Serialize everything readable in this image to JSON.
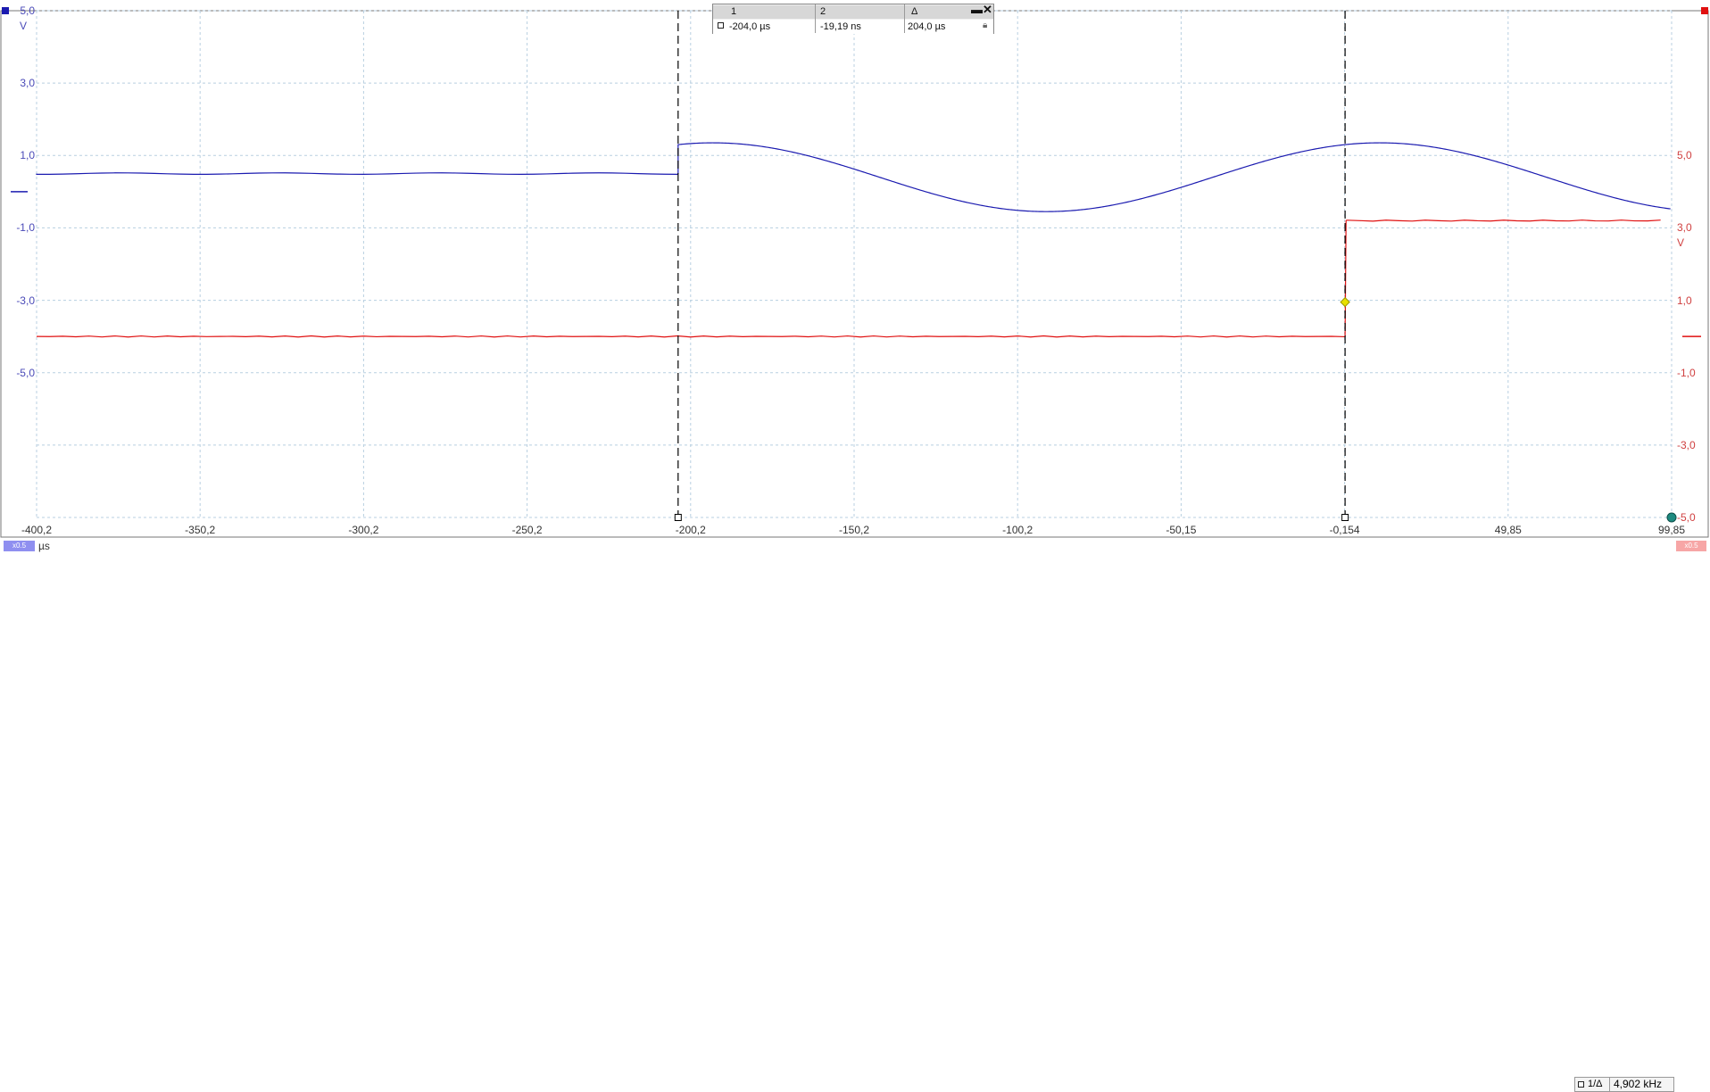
{
  "chart_data": {
    "type": "line",
    "x_unit": "µs",
    "xlim": [
      -400.2,
      99.85
    ],
    "x_ticks": [
      "-400,2",
      "-350,2",
      "-300,2",
      "-250,2",
      "-200,2",
      "-150,2",
      "-100,2",
      "-50,15",
      "-0,154",
      "49,85",
      "99,85"
    ],
    "grid": true,
    "series": [
      {
        "axis": "left",
        "color": "#1b1bb0",
        "unit": "V",
        "ylim": [
          -9.0,
          5.0
        ],
        "y_ticks": [
          "5,0",
          "3,0",
          "1,0",
          "-1,0",
          "-3,0",
          "-5,0"
        ],
        "baseline_before_step": 0.5,
        "step_x": -204.0,
        "after_step": {
          "shape": "sine",
          "center": 0.4,
          "amplitude": 0.95,
          "frequency_khz": 4.902,
          "start_value": 1.3
        }
      },
      {
        "axis": "right",
        "color": "#e01010",
        "unit": "V",
        "ylim": [
          -5.0,
          9.0
        ],
        "y_ticks": [
          "5,0",
          "3,0",
          "1,0",
          "-1,0",
          "-3,0",
          "-5,0"
        ],
        "baseline_before_step": 0.0,
        "step_x": -0.02,
        "after_step": {
          "shape": "level",
          "value": 3.2
        },
        "trigger_level": 0.95
      }
    ],
    "cursors": [
      {
        "label": "1",
        "x": -204.0
      },
      {
        "label": "2",
        "x": -0.019
      }
    ]
  },
  "cursor_table": {
    "headers": [
      "1",
      "2",
      "Δ"
    ],
    "values": [
      "-204,0 µs",
      "-19,19 ns",
      "204,0 µs"
    ]
  },
  "left_axis": {
    "unit": "V",
    "marker": "x0.5"
  },
  "right_axis": {
    "unit": "V",
    "marker": "x0.5"
  },
  "x_axis_unit": "µs",
  "measurement": {
    "mode": "1/Δ",
    "value": "4,902 kHz"
  },
  "colors": {
    "channel_a": "#1b1bb0",
    "channel_b": "#e01010",
    "grid": "#b8cfe0",
    "trigger": "#e8e000",
    "cursor": "#000000"
  }
}
